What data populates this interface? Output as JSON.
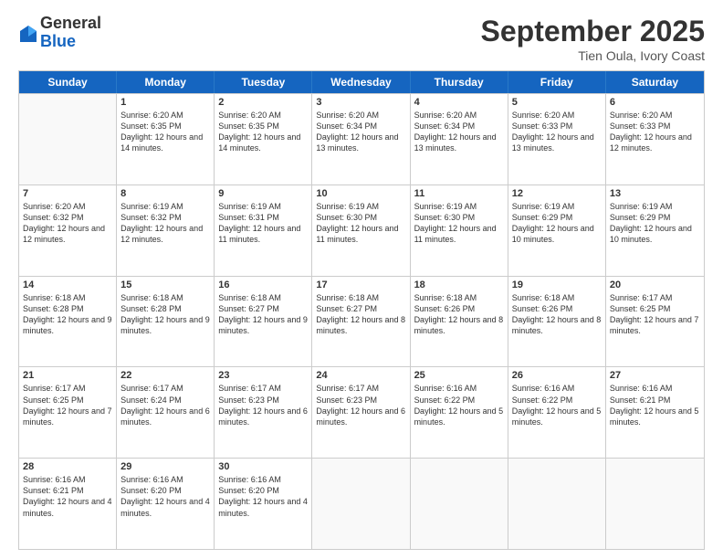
{
  "header": {
    "logo_general": "General",
    "logo_blue": "Blue",
    "month_title": "September 2025",
    "subtitle": "Tien Oula, Ivory Coast"
  },
  "weekdays": [
    "Sunday",
    "Monday",
    "Tuesday",
    "Wednesday",
    "Thursday",
    "Friday",
    "Saturday"
  ],
  "rows": [
    [
      {
        "day": "",
        "sunrise": "",
        "sunset": "",
        "daylight": ""
      },
      {
        "day": "1",
        "sunrise": "Sunrise: 6:20 AM",
        "sunset": "Sunset: 6:35 PM",
        "daylight": "Daylight: 12 hours and 14 minutes."
      },
      {
        "day": "2",
        "sunrise": "Sunrise: 6:20 AM",
        "sunset": "Sunset: 6:35 PM",
        "daylight": "Daylight: 12 hours and 14 minutes."
      },
      {
        "day": "3",
        "sunrise": "Sunrise: 6:20 AM",
        "sunset": "Sunset: 6:34 PM",
        "daylight": "Daylight: 12 hours and 13 minutes."
      },
      {
        "day": "4",
        "sunrise": "Sunrise: 6:20 AM",
        "sunset": "Sunset: 6:34 PM",
        "daylight": "Daylight: 12 hours and 13 minutes."
      },
      {
        "day": "5",
        "sunrise": "Sunrise: 6:20 AM",
        "sunset": "Sunset: 6:33 PM",
        "daylight": "Daylight: 12 hours and 13 minutes."
      },
      {
        "day": "6",
        "sunrise": "Sunrise: 6:20 AM",
        "sunset": "Sunset: 6:33 PM",
        "daylight": "Daylight: 12 hours and 12 minutes."
      }
    ],
    [
      {
        "day": "7",
        "sunrise": "Sunrise: 6:20 AM",
        "sunset": "Sunset: 6:32 PM",
        "daylight": "Daylight: 12 hours and 12 minutes."
      },
      {
        "day": "8",
        "sunrise": "Sunrise: 6:19 AM",
        "sunset": "Sunset: 6:32 PM",
        "daylight": "Daylight: 12 hours and 12 minutes."
      },
      {
        "day": "9",
        "sunrise": "Sunrise: 6:19 AM",
        "sunset": "Sunset: 6:31 PM",
        "daylight": "Daylight: 12 hours and 11 minutes."
      },
      {
        "day": "10",
        "sunrise": "Sunrise: 6:19 AM",
        "sunset": "Sunset: 6:30 PM",
        "daylight": "Daylight: 12 hours and 11 minutes."
      },
      {
        "day": "11",
        "sunrise": "Sunrise: 6:19 AM",
        "sunset": "Sunset: 6:30 PM",
        "daylight": "Daylight: 12 hours and 11 minutes."
      },
      {
        "day": "12",
        "sunrise": "Sunrise: 6:19 AM",
        "sunset": "Sunset: 6:29 PM",
        "daylight": "Daylight: 12 hours and 10 minutes."
      },
      {
        "day": "13",
        "sunrise": "Sunrise: 6:19 AM",
        "sunset": "Sunset: 6:29 PM",
        "daylight": "Daylight: 12 hours and 10 minutes."
      }
    ],
    [
      {
        "day": "14",
        "sunrise": "Sunrise: 6:18 AM",
        "sunset": "Sunset: 6:28 PM",
        "daylight": "Daylight: 12 hours and 9 minutes."
      },
      {
        "day": "15",
        "sunrise": "Sunrise: 6:18 AM",
        "sunset": "Sunset: 6:28 PM",
        "daylight": "Daylight: 12 hours and 9 minutes."
      },
      {
        "day": "16",
        "sunrise": "Sunrise: 6:18 AM",
        "sunset": "Sunset: 6:27 PM",
        "daylight": "Daylight: 12 hours and 9 minutes."
      },
      {
        "day": "17",
        "sunrise": "Sunrise: 6:18 AM",
        "sunset": "Sunset: 6:27 PM",
        "daylight": "Daylight: 12 hours and 8 minutes."
      },
      {
        "day": "18",
        "sunrise": "Sunrise: 6:18 AM",
        "sunset": "Sunset: 6:26 PM",
        "daylight": "Daylight: 12 hours and 8 minutes."
      },
      {
        "day": "19",
        "sunrise": "Sunrise: 6:18 AM",
        "sunset": "Sunset: 6:26 PM",
        "daylight": "Daylight: 12 hours and 8 minutes."
      },
      {
        "day": "20",
        "sunrise": "Sunrise: 6:17 AM",
        "sunset": "Sunset: 6:25 PM",
        "daylight": "Daylight: 12 hours and 7 minutes."
      }
    ],
    [
      {
        "day": "21",
        "sunrise": "Sunrise: 6:17 AM",
        "sunset": "Sunset: 6:25 PM",
        "daylight": "Daylight: 12 hours and 7 minutes."
      },
      {
        "day": "22",
        "sunrise": "Sunrise: 6:17 AM",
        "sunset": "Sunset: 6:24 PM",
        "daylight": "Daylight: 12 hours and 6 minutes."
      },
      {
        "day": "23",
        "sunrise": "Sunrise: 6:17 AM",
        "sunset": "Sunset: 6:23 PM",
        "daylight": "Daylight: 12 hours and 6 minutes."
      },
      {
        "day": "24",
        "sunrise": "Sunrise: 6:17 AM",
        "sunset": "Sunset: 6:23 PM",
        "daylight": "Daylight: 12 hours and 6 minutes."
      },
      {
        "day": "25",
        "sunrise": "Sunrise: 6:16 AM",
        "sunset": "Sunset: 6:22 PM",
        "daylight": "Daylight: 12 hours and 5 minutes."
      },
      {
        "day": "26",
        "sunrise": "Sunrise: 6:16 AM",
        "sunset": "Sunset: 6:22 PM",
        "daylight": "Daylight: 12 hours and 5 minutes."
      },
      {
        "day": "27",
        "sunrise": "Sunrise: 6:16 AM",
        "sunset": "Sunset: 6:21 PM",
        "daylight": "Daylight: 12 hours and 5 minutes."
      }
    ],
    [
      {
        "day": "28",
        "sunrise": "Sunrise: 6:16 AM",
        "sunset": "Sunset: 6:21 PM",
        "daylight": "Daylight: 12 hours and 4 minutes."
      },
      {
        "day": "29",
        "sunrise": "Sunrise: 6:16 AM",
        "sunset": "Sunset: 6:20 PM",
        "daylight": "Daylight: 12 hours and 4 minutes."
      },
      {
        "day": "30",
        "sunrise": "Sunrise: 6:16 AM",
        "sunset": "Sunset: 6:20 PM",
        "daylight": "Daylight: 12 hours and 4 minutes."
      },
      {
        "day": "",
        "sunrise": "",
        "sunset": "",
        "daylight": ""
      },
      {
        "day": "",
        "sunrise": "",
        "sunset": "",
        "daylight": ""
      },
      {
        "day": "",
        "sunrise": "",
        "sunset": "",
        "daylight": ""
      },
      {
        "day": "",
        "sunrise": "",
        "sunset": "",
        "daylight": ""
      }
    ]
  ]
}
